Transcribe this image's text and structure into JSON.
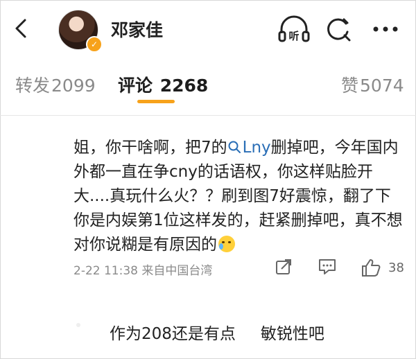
{
  "header": {
    "username": "邓家佳",
    "icons": [
      "back-arrow-icon",
      "headphones-listen-icon",
      "search-refresh-icon",
      "more-dots-icon"
    ],
    "listen_label": "听"
  },
  "tabs": [
    {
      "label": "转发",
      "count": "2099",
      "active": false
    },
    {
      "label": "评论",
      "count": "2268",
      "active": true
    },
    {
      "label": "赞",
      "count": "5074",
      "active": false
    }
  ],
  "comment": {
    "part1": "姐，你干啥啊，把7的",
    "link_text": "Lny",
    "part2": "删掉吧，今年国内外都一直在争cny的话语权，你这样贴脸开大....真玩什么火？？刷到图7好震惊，翻了下你是内娱第1位这样发的，赶紧删掉吧，真不想对你说糊是有原因的",
    "emoji": "crying-face-emoji",
    "time": "2-22 11:38",
    "source": "来自中国台湾",
    "like_count": "38"
  },
  "bottom": {
    "text_a": "作为208还是有点",
    "text_b": "敏锐性吧"
  },
  "colors": {
    "accent": "#f7a21b",
    "link": "#2a6eb6",
    "muted": "#8a8a8a"
  }
}
